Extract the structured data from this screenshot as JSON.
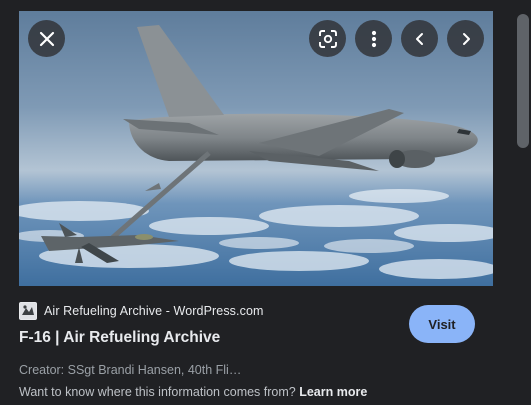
{
  "viewer": {
    "image_alt": "KC-46 tanker refueling an F-16 in flight",
    "controls": {
      "close": "close-icon",
      "lens": "lens-icon",
      "more": "more-vert-icon",
      "previous": "chevron-left-icon",
      "next": "chevron-right-icon"
    }
  },
  "source": {
    "name": "Air Refueling Archive - WordPress.com",
    "favicon": "wordpress-favicon"
  },
  "result": {
    "title": "F-16 | Air Refueling Archive",
    "visit_label": "Visit",
    "creator": "Creator: SSgt Brandi Hansen, 40th Fli…",
    "info_text": "Want to know where this information comes from? ",
    "learn_more": "Learn more"
  },
  "colors": {
    "background": "#202124",
    "accent": "#8ab4f8",
    "text": "#e8eaed",
    "secondary_text": "#9aa0a6"
  }
}
